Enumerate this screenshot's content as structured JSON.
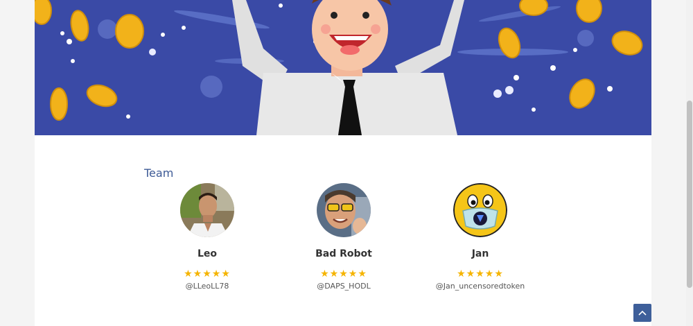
{
  "section": {
    "title": "Team"
  },
  "team": [
    {
      "name": "Leo",
      "stars": "★★★★★",
      "handle": "@LLeoLL78",
      "rating": 5
    },
    {
      "name": "Bad Robot",
      "stars": "★★★★★",
      "handle": "@DAPS_HODL",
      "rating": 5
    },
    {
      "name": "Jan",
      "stars": "★★★★★",
      "handle": "@Jan_uncensoredtoken",
      "rating": 5
    }
  ],
  "colors": {
    "hero_bg": "#3a4aa6",
    "heading": "#3d5a96",
    "star": "#f5b400",
    "back_to_top": "#3e5f9a"
  },
  "icons": {
    "back_to_top": "chevron-up-icon"
  }
}
